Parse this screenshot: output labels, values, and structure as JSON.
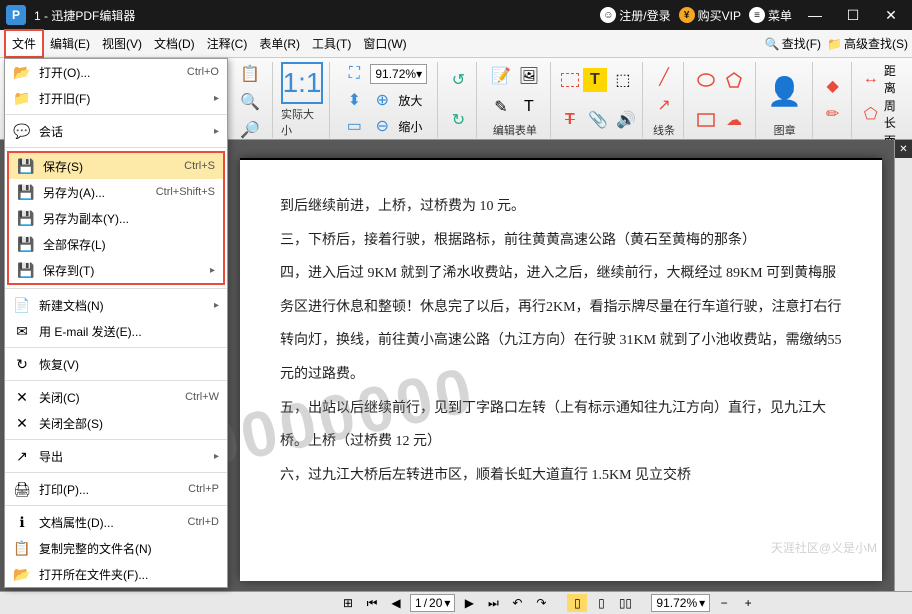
{
  "titlebar": {
    "title": "1 - 迅捷PDF编辑器",
    "register": "注册/登录",
    "vip": "购买VIP",
    "menu": "菜单"
  },
  "menubar": {
    "items": [
      "文件",
      "编辑(E)",
      "视图(V)",
      "文档(D)",
      "注释(C)",
      "表单(R)",
      "工具(T)",
      "窗口(W)"
    ],
    "find": "查找(F)",
    "advfind": "高级查找(S)"
  },
  "toolbar": {
    "zoom": "91.72%",
    "actual": "实际大小",
    "zoomin": "放大",
    "zoomout": "缩小",
    "editform": "编辑表单",
    "line": "线条",
    "shape": "图章",
    "dist": "距离",
    "perim": "周长",
    "area": "面积"
  },
  "dropdown": {
    "open": "打开(O)...",
    "open_s": "Ctrl+O",
    "openold": "打开旧(F)",
    "session": "会话",
    "save": "保存(S)",
    "save_s": "Ctrl+S",
    "saveas": "另存为(A)...",
    "saveas_s": "Ctrl+Shift+S",
    "savecopy": "另存为副本(Y)...",
    "saveall": "全部保存(L)",
    "saveto": "保存到(T)",
    "newdoc": "新建文档(N)",
    "email": "用 E-mail 发送(E)...",
    "restore": "恢复(V)",
    "close": "关闭(C)",
    "close_s": "Ctrl+W",
    "closeall": "关闭全部(S)",
    "export": "导出",
    "print": "打印(P)...",
    "print_s": "Ctrl+P",
    "props": "文档属性(D)...",
    "props_s": "Ctrl+D",
    "copyname": "复制完整的文件名(N)",
    "openfolder": "打开所在文件夹(F)..."
  },
  "doc": {
    "p1": "到后继续前进，上桥，过桥费为 10 元。",
    "p2": "三，下桥后，接着行驶，根据路标，前往黄黄高速公路（黄石至黄梅的那条）",
    "p3": "四，进入后过 9KM 就到了浠水收费站，进入之后，继续前行，大概经过 89KM 可到黄梅服务区进行休息和整顿！休息完了以后，再行2KM，看指示牌尽量在行车道行驶，注意打右行转向灯，换线，前往黄小高速公路（九江方向）在行驶 31KM 就到了小池收费站，需缴纳55 元的过路费。",
    "p4": "五，出站以后继续前行，见到丁字路口左转（上有标示通知往九江方向）直行，见九江大桥。上桥（过桥费 12 元）",
    "p5": "六，过九江大桥后左转进市区，顺着长虹大道直行 1.5KM 见立交桥"
  },
  "watermark": "0000000",
  "corner_wm": "天涯社区@义是小M",
  "status": {
    "page_cur": "1",
    "page_sep": "/",
    "page_tot": "20",
    "zoom": "91.72%"
  }
}
